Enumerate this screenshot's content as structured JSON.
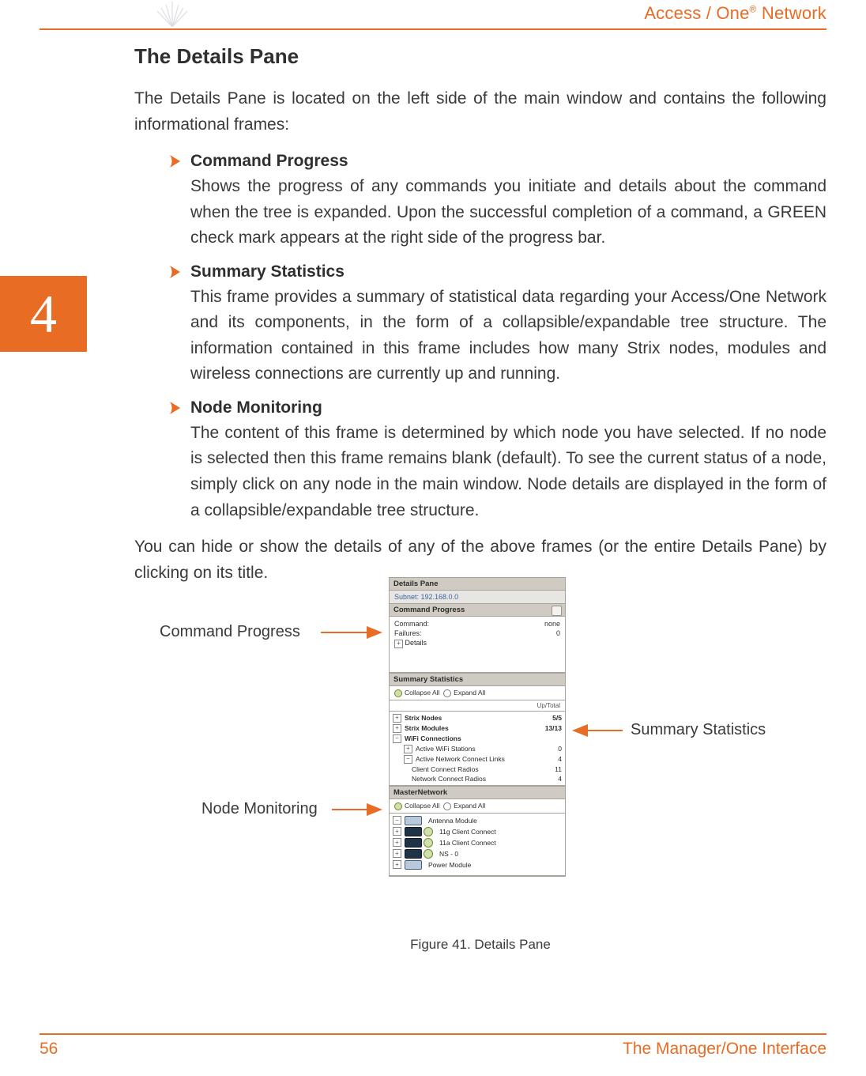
{
  "header": {
    "product": "Access / One",
    "reg": "®",
    "suffix": " Network"
  },
  "chapter_number": "4",
  "title": "The Details Pane",
  "intro": "The Details Pane is located on the left side of the main window and contains the following informational frames:",
  "bullets": [
    {
      "label": "Command Progress",
      "body": "Shows the progress of any commands you initiate and details about the command when the tree is expanded. Upon the successful completion of a command, a GREEN check mark appears at the right side of the progress bar."
    },
    {
      "label": "Summary Statistics",
      "body": "This frame provides a summary of statistical data regarding your Access/One Network and its components, in the form of a collapsible/expandable tree structure. The information contained in this frame includes how many Strix nodes, modules and wireless connections are currently up and running."
    },
    {
      "label": "Node Monitoring",
      "body": "The content of this frame is determined by which node you have selected. If no node is selected then this frame remains blank (default). To see the current status of a node, simply click on any node in the main window. Node details are displayed in the form of a collapsible/expandable tree structure."
    }
  ],
  "outro": "You can hide or show the details of any of the above frames (or the entire Details Pane) by clicking on its title.",
  "figure": {
    "caption": "Figure 41. Details Pane",
    "annotations": {
      "cmd": "Command Progress",
      "sum": "Summary Statistics",
      "node": "Node Monitoring"
    },
    "panel": {
      "title": "Details Pane",
      "subnet": "Subnet: 192.168.0.0",
      "command_progress": {
        "header": "Command Progress",
        "rows": [
          {
            "k": "Command:",
            "v": "none"
          },
          {
            "k": "Failures:",
            "v": "0"
          }
        ],
        "details_label": "Details"
      },
      "summary_statistics": {
        "header": "Summary Statistics",
        "collapse_all": "Collapse All",
        "expand_all": "Expand All",
        "col_header": "Up/Total",
        "rows": [
          {
            "label": "Strix Nodes",
            "val": "5/5",
            "bold": true
          },
          {
            "label": "Strix Modules",
            "val": "13/13",
            "bold": true
          },
          {
            "label": "WiFi Connections",
            "val": "",
            "bold": true
          },
          {
            "label": "Active WiFi Stations",
            "val": "0",
            "indent": 1
          },
          {
            "label": "Active Network Connect Links",
            "val": "4",
            "indent": 1
          },
          {
            "label": "Client Connect Radios",
            "val": "11",
            "indent": 2
          },
          {
            "label": "Network Connect Radios",
            "val": "4",
            "indent": 2
          }
        ]
      },
      "master_network": {
        "header": "MasterNetwork",
        "collapse_all": "Collapse All",
        "expand_all": "Expand All",
        "rows": [
          "Antenna Module",
          "11g Client Connect",
          "11a Client Connect",
          "NS - 0",
          "Power Module"
        ]
      }
    }
  },
  "footer": {
    "page": "56",
    "title": "The Manager/One Interface"
  }
}
